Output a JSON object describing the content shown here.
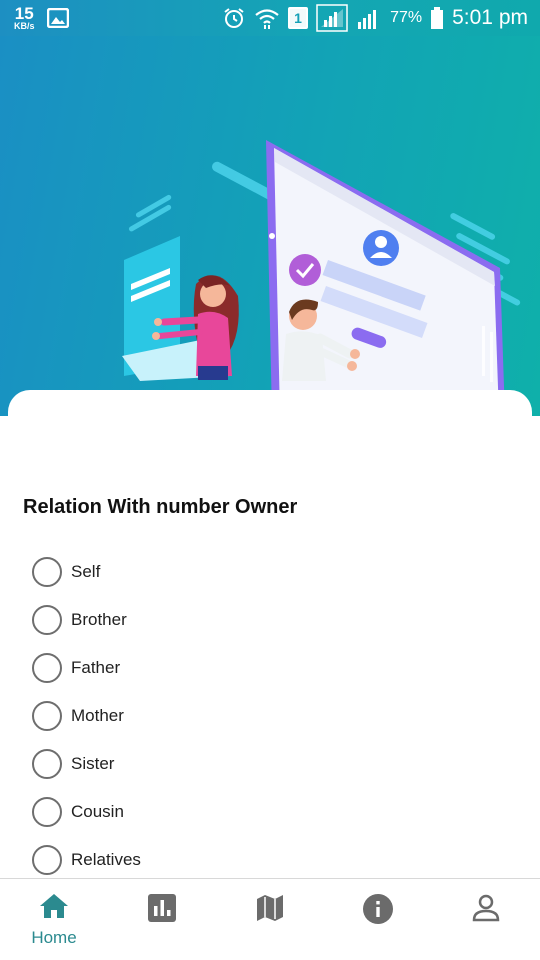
{
  "status_bar": {
    "net_speed": "15",
    "net_unit": "KB/s",
    "sim_slot": "1",
    "battery_percent": "77%",
    "time": "5:01 pm",
    "icons": [
      "gallery-icon",
      "alarm-icon",
      "wifi-icon",
      "signal-icon",
      "signal-icon",
      "battery-icon"
    ]
  },
  "hero": {
    "illustration": "profile-verification-illustration",
    "colors": {
      "gradient_start": "#1a8fc4",
      "gradient_end": "#0fb0aa",
      "accent_purple": "#8b6cf0"
    }
  },
  "form": {
    "question": "Relation With number Owner",
    "options": [
      {
        "label": "Self",
        "selected": false
      },
      {
        "label": "Brother",
        "selected": false
      },
      {
        "label": "Father",
        "selected": false
      },
      {
        "label": "Mother",
        "selected": false
      },
      {
        "label": "Sister",
        "selected": false
      },
      {
        "label": "Cousin",
        "selected": false
      },
      {
        "label": "Relatives",
        "selected": false
      }
    ]
  },
  "bottom_nav": {
    "active": "Home",
    "accent_color": "#2b8a8f",
    "items": [
      {
        "label": "Home",
        "icon": "home-icon"
      },
      {
        "label": "",
        "icon": "bar-chart-icon"
      },
      {
        "label": "",
        "icon": "map-icon"
      },
      {
        "label": "",
        "icon": "info-icon"
      },
      {
        "label": "",
        "icon": "person-icon"
      }
    ]
  }
}
